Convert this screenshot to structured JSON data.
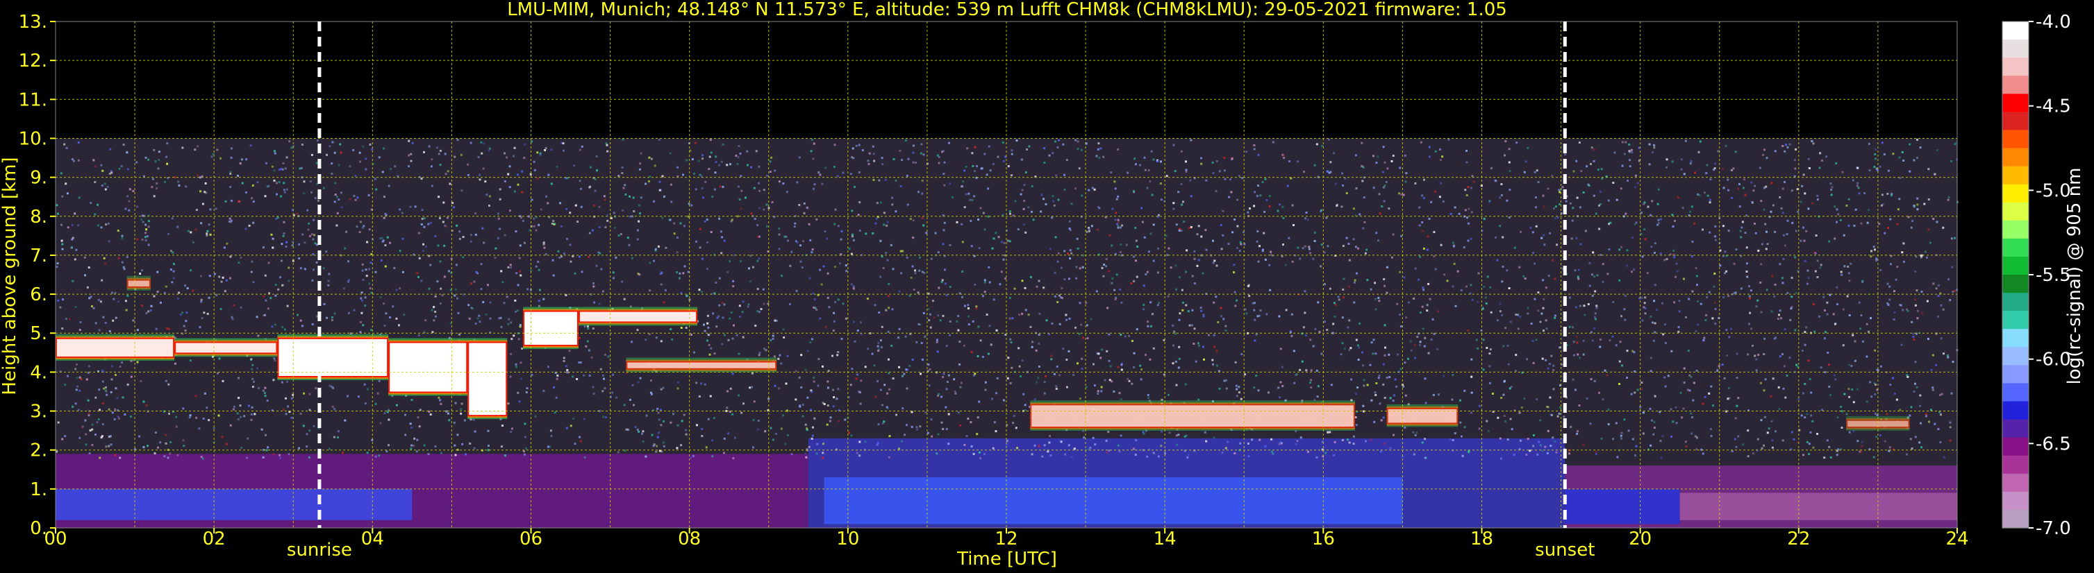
{
  "chart_data": {
    "type": "heatmap",
    "title": "LMU-MIM, Munich; 48.148° N 11.573° E, altitude: 539 m    Lufft CHM8k (CHM8kLMU): 29-05-2021    firmware: 1.05",
    "xlabel": "Time [UTC]",
    "ylabel": "Height above ground [km]",
    "xlim": [
      0,
      24
    ],
    "ylim": [
      0,
      13
    ],
    "x_ticks": [
      "00",
      "02",
      "04",
      "06",
      "08",
      "10",
      "12",
      "14",
      "16",
      "18",
      "20",
      "22",
      "24"
    ],
    "y_ticks": [
      "0.",
      "1.",
      "2.",
      "3.",
      "4.",
      "5.",
      "6.",
      "7.",
      "8.",
      "9.",
      "10.",
      "11.",
      "12.",
      "13."
    ],
    "grid": true,
    "colorbar": {
      "label": "log(rc-signal) @ 905 nm",
      "range": [
        -7.0,
        -4.0
      ],
      "ticks": [
        "-4.0",
        "-4.5",
        "-5.0",
        "-5.5",
        "-6.0",
        "-6.5",
        "-7.0"
      ],
      "colors": [
        "#ffffff",
        "#e8e0e0",
        "#f4c4c4",
        "#f08c8c",
        "#ff0000",
        "#dd2222",
        "#ff5500",
        "#ff8800",
        "#ffbb00",
        "#ffee00",
        "#ddff44",
        "#99ff66",
        "#33dd55",
        "#11bb33",
        "#118822",
        "#22aa88",
        "#33ccaa",
        "#88ddff",
        "#99bbff",
        "#8899ff",
        "#5566ff",
        "#2222dd",
        "#5522aa",
        "#881188",
        "#aa3399",
        "#c066b0",
        "#c890c8",
        "#b8a0c0"
      ]
    },
    "signal_top_km": 10.0,
    "annotations": [
      {
        "label": "sunrise",
        "time_h": 3.33
      },
      {
        "label": "sunset",
        "time_h": 19.05
      }
    ],
    "cloud_layers": [
      {
        "t_start": 0.0,
        "t_end": 1.5,
        "base_km": 4.4,
        "top_km": 4.9,
        "intensity": 0.9
      },
      {
        "t_start": 1.5,
        "t_end": 2.8,
        "base_km": 4.5,
        "top_km": 4.8,
        "intensity": 0.9
      },
      {
        "t_start": 2.8,
        "t_end": 4.2,
        "base_km": 3.9,
        "top_km": 4.9,
        "intensity": 1.0
      },
      {
        "t_start": 4.2,
        "t_end": 5.2,
        "base_km": 3.5,
        "top_km": 4.8,
        "intensity": 1.0
      },
      {
        "t_start": 5.2,
        "t_end": 5.7,
        "base_km": 2.9,
        "top_km": 4.8,
        "intensity": 1.0
      },
      {
        "t_start": 5.9,
        "t_end": 6.6,
        "base_km": 4.7,
        "top_km": 5.6,
        "intensity": 1.0
      },
      {
        "t_start": 6.6,
        "t_end": 8.1,
        "base_km": 5.3,
        "top_km": 5.6,
        "intensity": 0.9
      },
      {
        "t_start": 7.2,
        "t_end": 9.1,
        "base_km": 4.1,
        "top_km": 4.3,
        "intensity": 0.7
      },
      {
        "t_start": 0.9,
        "t_end": 1.2,
        "base_km": 6.2,
        "top_km": 6.4,
        "intensity": 0.6
      },
      {
        "t_start": 12.3,
        "t_end": 16.4,
        "base_km": 2.6,
        "top_km": 3.2,
        "intensity": 0.7
      },
      {
        "t_start": 16.8,
        "t_end": 17.7,
        "base_km": 2.7,
        "top_km": 3.1,
        "intensity": 0.7
      },
      {
        "t_start": 22.6,
        "t_end": 23.4,
        "base_km": 2.6,
        "top_km": 2.8,
        "intensity": 0.5
      }
    ]
  }
}
